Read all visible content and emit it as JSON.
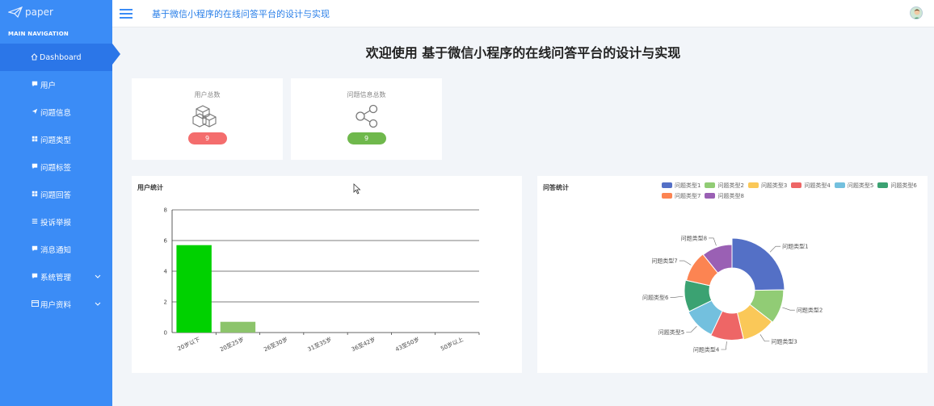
{
  "brand": {
    "name": "paper"
  },
  "sidebar": {
    "section_title": "MAIN NAVIGATION",
    "items": [
      {
        "label": "Dashboard",
        "icon": "home-icon",
        "active": true
      },
      {
        "label": "用户",
        "icon": "comment-icon"
      },
      {
        "label": "问题信息",
        "icon": "send-icon"
      },
      {
        "label": "问题类型",
        "icon": "grid-icon"
      },
      {
        "label": "问题标签",
        "icon": "comment-icon"
      },
      {
        "label": "问题回答",
        "icon": "grid-icon"
      },
      {
        "label": "投诉举报",
        "icon": "list-icon"
      },
      {
        "label": "消息通知",
        "icon": "comment-icon"
      },
      {
        "label": "系统管理",
        "icon": "comment-icon",
        "expandable": true
      },
      {
        "label": "用户资料",
        "icon": "card-icon",
        "expandable": true
      }
    ]
  },
  "header": {
    "title": "基于微信小程序的在线问答平台的设计与实现"
  },
  "main": {
    "welcome": "欢迎使用 基于微信小程序的在线问答平台的设计与实现",
    "stats": [
      {
        "label": "用户总数",
        "value": "9",
        "color": "#f46d6d",
        "icon": "cubes-icon"
      },
      {
        "label": "问题信息总数",
        "value": "9",
        "color": "#6fb84c",
        "icon": "share-nodes-icon"
      }
    ]
  },
  "chart_data": [
    {
      "type": "bar",
      "title": "用户统计",
      "categories": [
        "20岁以下",
        "20至25岁",
        "26至30岁",
        "31至35岁",
        "36至42岁",
        "43至50岁",
        "50岁以上"
      ],
      "values": [
        5.7,
        0.7,
        0,
        0,
        0,
        0,
        0
      ],
      "bar_colors": [
        "#00d100",
        "#8cc46b",
        "#8cc46b",
        "#8cc46b",
        "#8cc46b",
        "#8cc46b",
        "#8cc46b"
      ],
      "ylim": [
        0,
        8
      ],
      "yticks": [
        0,
        2,
        4,
        6,
        8
      ]
    },
    {
      "type": "pie",
      "title": "问答统计",
      "labels": [
        "问题类型1",
        "问题类型2",
        "问题类型3",
        "问题类型4",
        "问题类型5",
        "问题类型6",
        "问题类型7",
        "问题类型8"
      ],
      "label_order_on_chart": [
        "问题类型1",
        "问题类型2",
        "问题类型3",
        "问题类型4",
        "问题类型5",
        "问题类型6",
        "问题类型7",
        "问题类型8"
      ],
      "values": [
        3,
        1.3,
        1.3,
        1.3,
        1.3,
        1.3,
        1.3,
        1.3
      ],
      "colors": [
        "#5470c6",
        "#91cc75",
        "#fac858",
        "#ee6666",
        "#73c0de",
        "#3ba272",
        "#fc8452",
        "#9a60b4"
      ],
      "slice_labels": [
        "问题类型1",
        "问题类型2",
        "问题类型3",
        "问题类型4",
        "问题类型5",
        "问题类型6",
        "问题类型7",
        "问题类型8"
      ],
      "legend_placement": "top-right"
    }
  ]
}
